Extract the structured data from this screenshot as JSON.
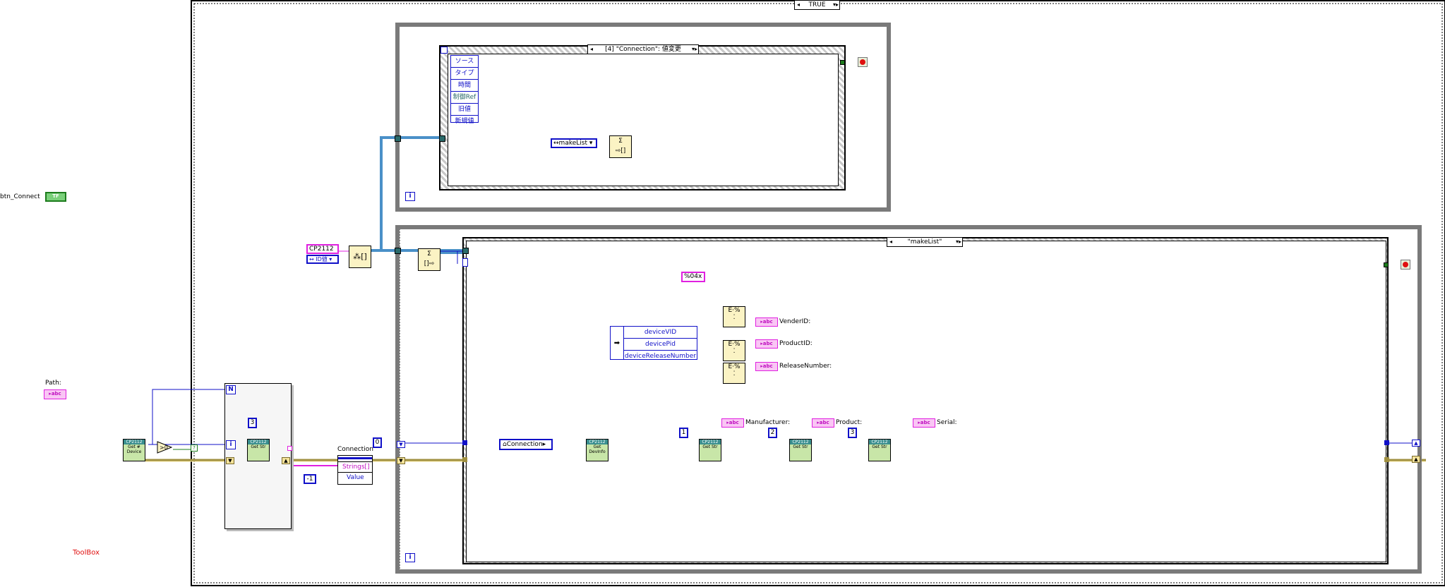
{
  "case_outer": {
    "selector": "TRUE"
  },
  "controls": {
    "btn_connect": {
      "label": "btn_Connect",
      "glyph": "TF"
    },
    "path": {
      "label": "Path:",
      "glyph": "abc"
    }
  },
  "left_subvi": {
    "header": "CP2112",
    "body": "Get # Device"
  },
  "for_loop": {
    "count_label": "N",
    "iter_label": "i",
    "const": "3",
    "subvi_header": "CP2112",
    "subvi_body": "Get Str"
  },
  "ring_control": {
    "label": "Connection",
    "items": [
      "Strings[]",
      "Value"
    ],
    "const_neg1": "-1",
    "const_zero": "0"
  },
  "cp2112_const": {
    "value": "CP2112",
    "sub": "↔ ID値"
  },
  "event_top": {
    "selector": "[4] \"Connection\": 値変更",
    "event_data": [
      "ソース",
      "タイプ",
      "時間",
      "制御Ref",
      "旧値",
      "新規値"
    ],
    "enum_value": "makeList",
    "iter": "i"
  },
  "event_bottom": {
    "selector": "\"makeList\"",
    "iter": "i",
    "ref_const": "Connection",
    "format_const": "%04x",
    "unbundle_items": [
      "deviceVID",
      "devicePid",
      "deviceReleaseNumber"
    ],
    "indicators": [
      "VenderID:",
      "ProductID:",
      "ReleaseNumber:"
    ],
    "string_indicators": [
      "Manufacturer:",
      "Product:",
      "Serial:"
    ],
    "consts": [
      "1",
      "2",
      "3"
    ],
    "subvi_header": "CP2112",
    "get_info_body": "Get DevInfo",
    "get_str_body": "Get Str"
  },
  "free_label": "ToolBox",
  "colors": {
    "wire_blue": "#1010c8",
    "wire_pink": "#e020e0",
    "wire_rose": "#b0442a",
    "wire_yellow": "#a09040",
    "wire_green": "#1d7c1d",
    "wire_cyan": "#4a90c8"
  }
}
